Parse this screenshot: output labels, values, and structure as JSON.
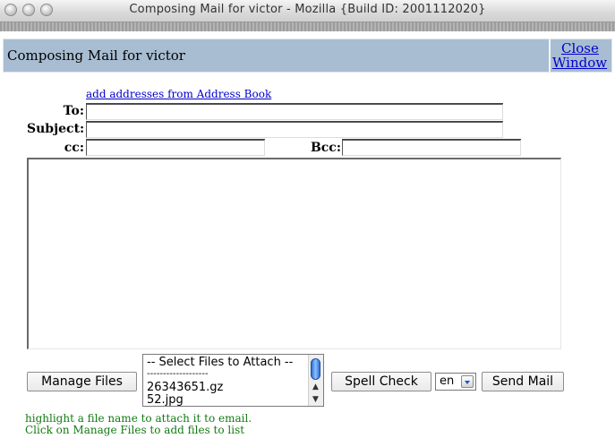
{
  "window": {
    "title": "Composing Mail for victor - Mozilla {Build ID: 2001112020}"
  },
  "header": {
    "title": "Composing Mail for victor",
    "close_line1": "Close",
    "close_line2": "Window"
  },
  "form": {
    "address_book_link": "add addresses from Address Book",
    "to_label": "To:",
    "subject_label": "Subject:",
    "cc_label": "cc:",
    "bcc_label": "Bcc:"
  },
  "buttons": {
    "manage_files": "Manage Files",
    "spell_check": "Spell Check",
    "send_mail": "Send Mail"
  },
  "attachments": {
    "options": [
      "-- Select Files to Attach --",
      "-------------------",
      "26343651.gz",
      "52.jpg"
    ]
  },
  "language": {
    "selected": "en"
  },
  "hints": {
    "line1": "highlight a file name to attach it to email.",
    "line2": "Click on Manage Files to add files to list"
  }
}
